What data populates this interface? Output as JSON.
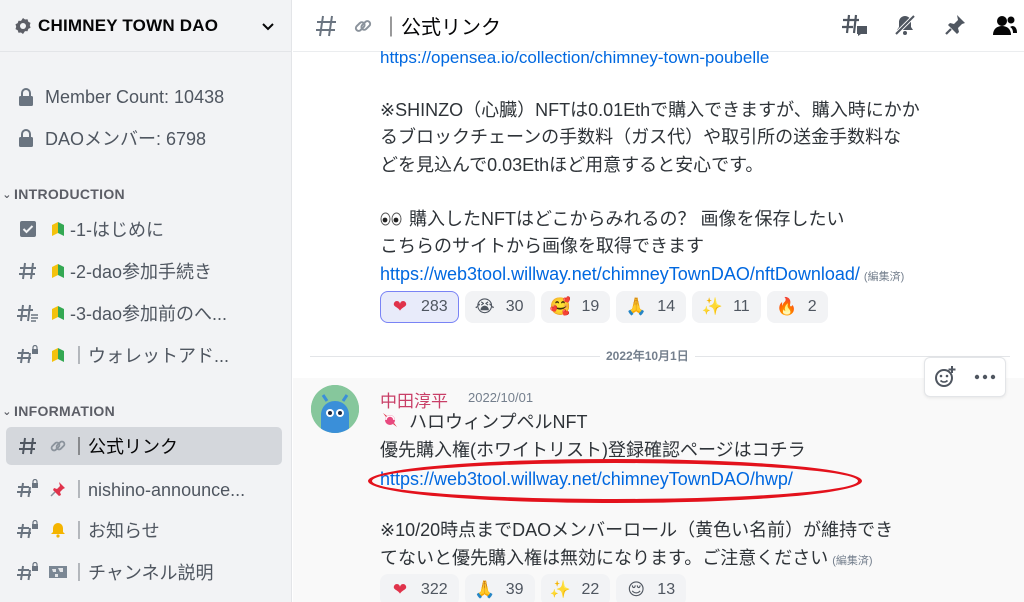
{
  "server": {
    "name": "CHIMNEY TOWN DAO"
  },
  "stats": [
    {
      "label": "Member Count: 10438"
    },
    {
      "label": "DAOメンバー: 6798"
    }
  ],
  "categories": {
    "introduction": "INTRODUCTION",
    "information": "INFORMATION"
  },
  "channels": [
    {
      "label": "-1-はじめに"
    },
    {
      "label": "-2-dao参加手続き"
    },
    {
      "label": "-3-dao参加前のへ..."
    },
    {
      "label": "｜ウォレットアド..."
    },
    {
      "label": "｜公式リンク"
    },
    {
      "label": "｜nishino-announce..."
    },
    {
      "label": "｜お知らせ"
    },
    {
      "label": "｜チャンネル説明"
    }
  ],
  "header": {
    "title": "｜公式リンク"
  },
  "message1": {
    "partial_link": "https://opensea.io/collection/chimney-town-poubelle",
    "lines": [
      "※SHINZO（心臓）NFTは0.01Ethで購入できますが、購入時にかか",
      "るブロックチェーンの手数料（ガス代）や取引所の送金手数料な",
      "どを見込んで0.03Ethほど用意すると安心です。"
    ],
    "question": "購入したNFTはどこからみれるの？ 画像を保存したい",
    "answer": "こちらのサイトから画像を取得できます",
    "link": "https://web3tool.willway.net/chimneyTownDAO/nftDownload/",
    "edited": "(編集済)",
    "reactions": [
      {
        "emoji": "❤",
        "count": "283",
        "me": true
      },
      {
        "emoji": "😭",
        "count": "30"
      },
      {
        "emoji": "🥰",
        "count": "19"
      },
      {
        "emoji": "🙏",
        "count": "14"
      },
      {
        "emoji": "✨",
        "count": "11"
      },
      {
        "emoji": "🔥",
        "count": "2"
      }
    ]
  },
  "divider": {
    "date": "2022年10月1日"
  },
  "message2": {
    "author": "中田淳平",
    "timestamp": "2022/10/01",
    "line1": "ハロウィンプペルNFT",
    "line2": "優先購入権(ホワイトリスト)登録確認ページはコチラ",
    "link": "https://web3tool.willway.net/chimneyTownDAO/hwp/",
    "note1": "※10/20時点までDAOメンバーロール（黄色い名前）が維持でき",
    "note2": "てないと優先購入権は無効になります。ご注意ください",
    "edited": "(編集済)",
    "reactions": [
      {
        "emoji": "❤",
        "count": "322"
      },
      {
        "emoji": "🙏",
        "count": "39"
      },
      {
        "emoji": "✨",
        "count": "22"
      },
      {
        "emoji": "😌",
        "count": "13"
      }
    ]
  },
  "colors": {
    "link": "#0068e0",
    "author": "#c93f67",
    "highlight_oval": "#e3121c",
    "active_reaction_border": "#7983f5"
  }
}
